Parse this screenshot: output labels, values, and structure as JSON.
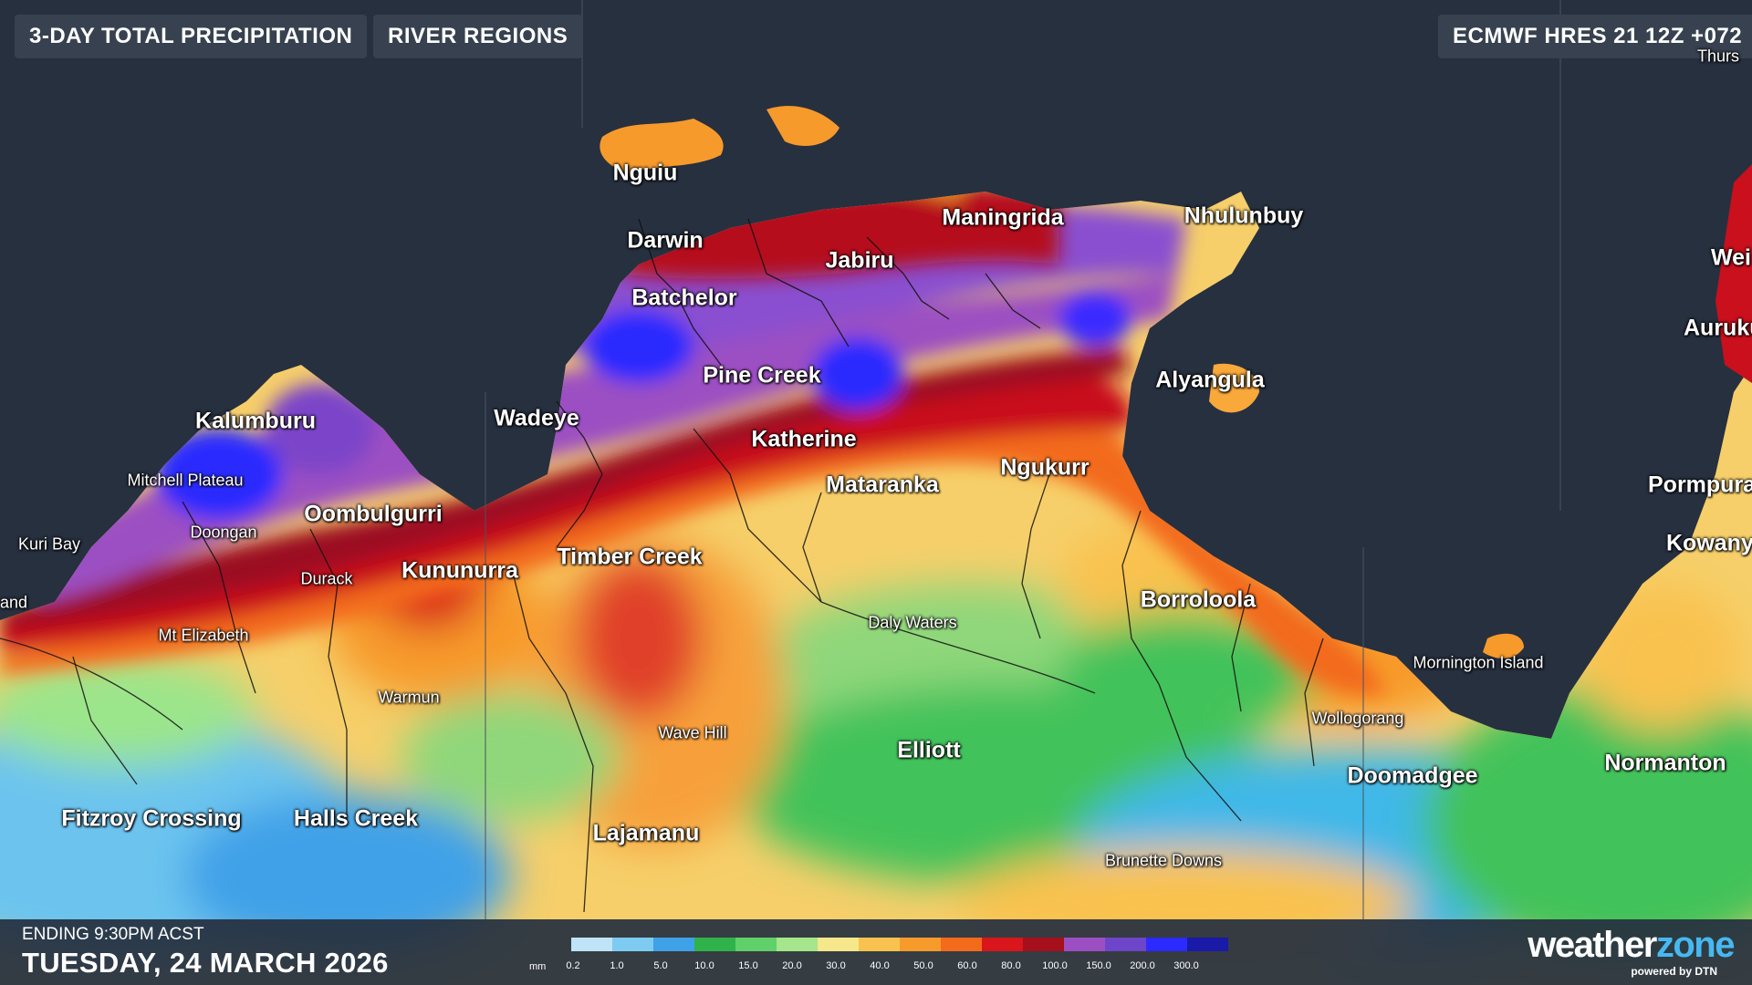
{
  "map": {
    "title": "3-DAY TOTAL PRECIPITATION",
    "ocean_color": "#27303f"
  },
  "toolbar": {
    "precip_button": "3-DAY TOTAL PRECIPITATION",
    "regions_button": "RIVER REGIONS",
    "model_run": "ECMWF HRES 21 12Z +072"
  },
  "places": {
    "nguiu": "Nguiu",
    "darwin": "Darwin",
    "jabiru": "Jabiru",
    "maningrida": "Maningrida",
    "nhulunbuy": "Nhulunbuy",
    "batchelor": "Batchelor",
    "pine_creek": "Pine Creek",
    "alyangula": "Alyangula",
    "wadeye": "Wadeye",
    "kalumburu": "Kalumburu",
    "katherine": "Katherine",
    "mitchell_plateau": "Mitchell Plateau",
    "ngukurr": "Ngukurr",
    "mataranka": "Mataranka",
    "oombulgurri": "Oombulgurri",
    "doongan": "Doongan",
    "kuri_bay": "Kuri Bay",
    "timber_creek": "Timber Creek",
    "kununurra": "Kununurra",
    "durack": "Durack",
    "borroloola": "Borroloola",
    "daly_waters": "Daly Waters",
    "mt_elizabeth": "Mt Elizabeth",
    "mornington_island": "Mornington Island",
    "warmun": "Warmun",
    "wollogorang": "Wollogorang",
    "wave_hill": "Wave Hill",
    "elliott": "Elliott",
    "doomadgee": "Doomadgee",
    "normanton": "Normanton",
    "fitzroy_crossing": "Fitzroy Crossing",
    "halls_creek": "Halls Creek",
    "lajamanu": "Lajamanu",
    "brunette_downs": "Brunette Downs",
    "weipa": "Wei",
    "aurukun": "Auruku",
    "pormpuraaw": "Pormpura",
    "kowanyama": "Kowanya",
    "thursday": "Thurs",
    "derby": "and"
  },
  "footer": {
    "ending": "ENDING 9:30PM ACST",
    "date": "TUESDAY, 24 MARCH 2026"
  },
  "legend": {
    "unit": "mm",
    "labels": [
      "0.2",
      "1.0",
      "5.0",
      "10.0",
      "15.0",
      "20.0",
      "30.0",
      "40.0",
      "50.0",
      "60.0",
      "80.0",
      "100.0",
      "150.0",
      "200.0",
      "300.0"
    ],
    "colors": [
      "#bfe4f7",
      "#7ecbf2",
      "#3fa1e8",
      "#2fb24a",
      "#5fd06a",
      "#a5e58b",
      "#f6e78a",
      "#f9c24f",
      "#f79a2c",
      "#f36a1b",
      "#d8161b",
      "#a60f1c",
      "#9b4fc2",
      "#6d45c9",
      "#2b2bff",
      "#1a1aa8"
    ]
  },
  "brand": {
    "logo_main": "weather",
    "logo_accent": "zone",
    "logo_sub": "powered by DTN"
  }
}
